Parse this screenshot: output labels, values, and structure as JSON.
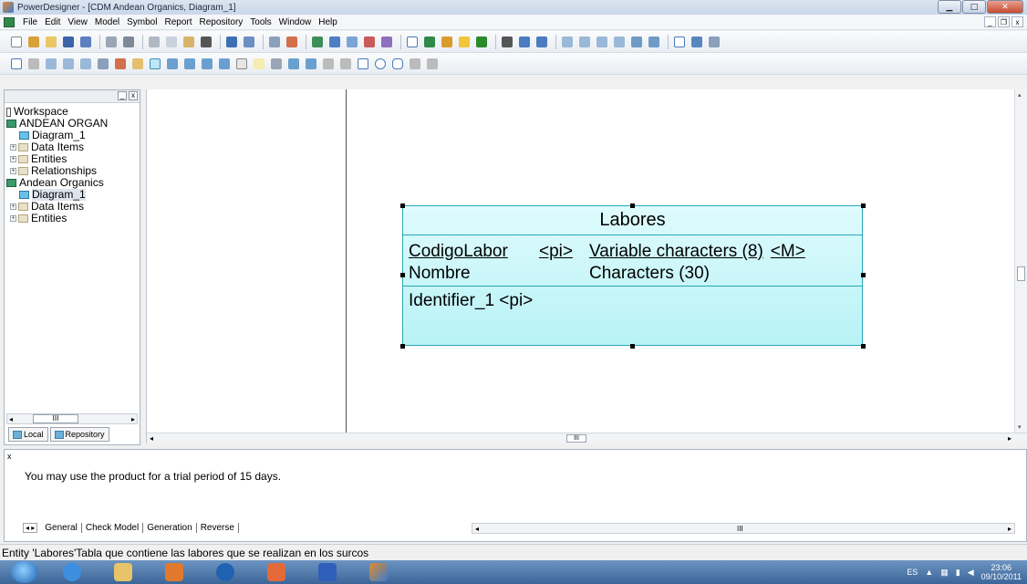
{
  "window": {
    "title": "PowerDesigner - [CDM Andean Organics, Diagram_1]"
  },
  "menu": [
    "File",
    "Edit",
    "View",
    "Model",
    "Symbol",
    "Report",
    "Repository",
    "Tools",
    "Window",
    "Help"
  ],
  "browser": {
    "tree": [
      {
        "label": "Workspace",
        "icon": "workspace-icon",
        "depth": 0
      },
      {
        "label": "ANDEAN ORGAN",
        "icon": "model-icon",
        "depth": 0
      },
      {
        "label": "Diagram_1",
        "icon": "diagram-icon",
        "depth": 1
      },
      {
        "label": "Data Items",
        "icon": "folder-icon",
        "depth": 1
      },
      {
        "label": "Entities",
        "icon": "folder-icon",
        "depth": 1
      },
      {
        "label": "Relationships",
        "icon": "folder-icon",
        "depth": 1
      },
      {
        "label": "Andean Organics",
        "icon": "model-icon",
        "depth": 0
      },
      {
        "label": "Diagram_1",
        "icon": "diagram-icon",
        "depth": 1
      },
      {
        "label": "Data Items",
        "icon": "folder-icon",
        "depth": 1
      },
      {
        "label": "Entities",
        "icon": "folder-icon",
        "depth": 1
      }
    ],
    "tabs": {
      "local": "Local",
      "repository": "Repository"
    },
    "scroll_label": "III"
  },
  "entity": {
    "name": "Labores",
    "attributes": [
      {
        "name": "CodigoLabor",
        "key": "<pi>",
        "type": "Variable characters (8)",
        "mandatory": "<M>"
      },
      {
        "name": "Nombre",
        "key": "",
        "type": "Characters (30)",
        "mandatory": ""
      }
    ],
    "identifier": "Identifier_1  <pi>"
  },
  "canvas": {
    "hscroll_label": "III"
  },
  "output": {
    "message": "You may use the product for a trial period of 15 days.",
    "tabs": [
      "General",
      "Check Model",
      "Generation",
      "Reverse"
    ],
    "scroll_label": "III"
  },
  "status": {
    "text": "Entity 'Labores'Tabla que contiene las labores que se realizan en los surcos"
  },
  "taskbar": {
    "lang": "ES",
    "time": "23:06",
    "date": "09/10/2011"
  }
}
